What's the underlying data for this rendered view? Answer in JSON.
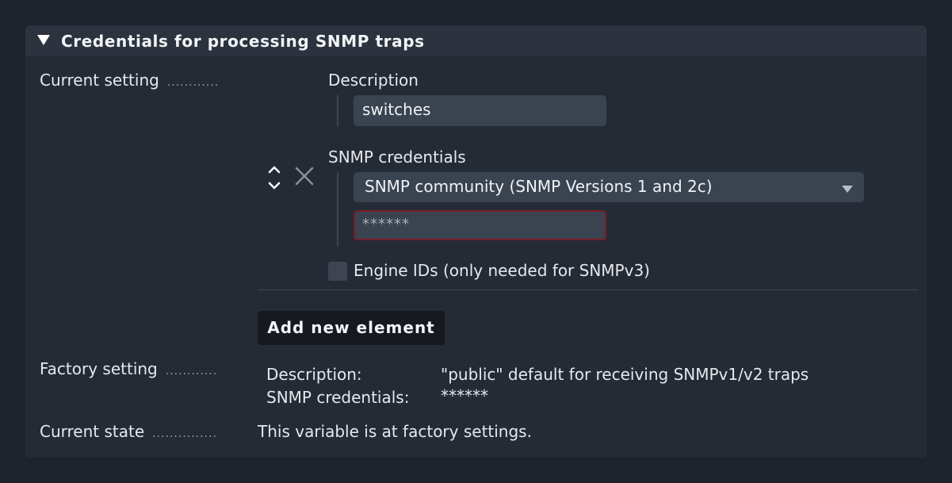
{
  "section": {
    "title": "Credentials for processing SNMP traps"
  },
  "rows": {
    "current_setting": "Current setting",
    "factory_setting": "Factory setting",
    "current_state": "Current state",
    "dots_current": "............",
    "dots_factory": "............",
    "dots_state": "..............."
  },
  "entry": {
    "description_label": "Description",
    "description_value": "switches",
    "credentials_label": "SNMP credentials",
    "credentials_type": "SNMP community (SNMP Versions 1 and 2c)",
    "community_value": "******",
    "engine_ids_label": "Engine IDs (only needed for SNMPv3)",
    "engine_ids_checked": false
  },
  "add_button": "Add new element",
  "factory": {
    "description_key": "Description:",
    "description_value": "\"public\" default for receiving SNMPv1/v2 traps",
    "credentials_key": "SNMP credentials:",
    "credentials_value": "******"
  },
  "state": {
    "text": "This variable is at factory settings."
  }
}
